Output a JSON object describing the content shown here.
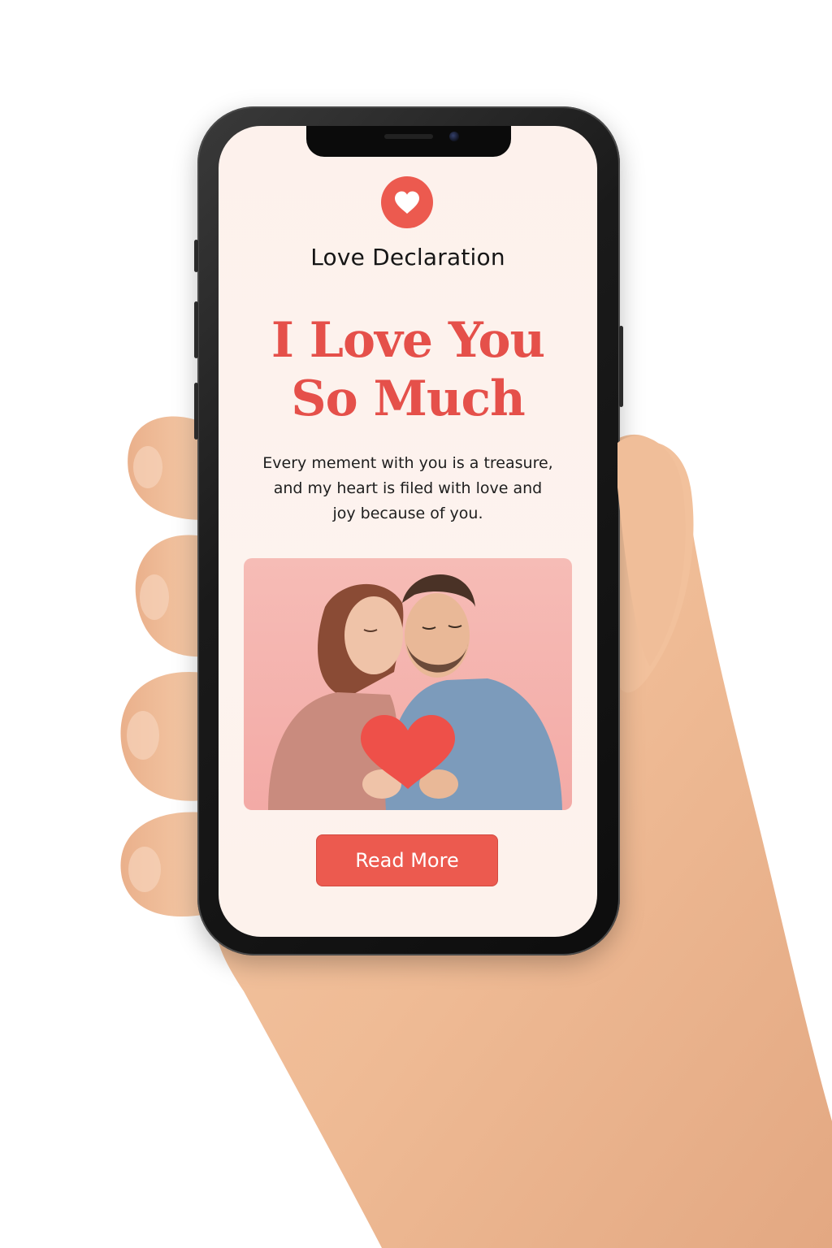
{
  "app": {
    "title": "Love Declaration",
    "logo_icon": "heart-icon"
  },
  "hero": {
    "headline_line1": "I Love You",
    "headline_line2": "So Much"
  },
  "message": {
    "line1": "Every mement with you is a treasure,",
    "line2": "and my heart is filed with love and",
    "line3": "joy because of you."
  },
  "photo": {
    "alt": "couple-holding-heart-photo"
  },
  "actions": {
    "read_more_label": "Read More"
  },
  "colors": {
    "accent": "#ec5a4f",
    "headline": "#e5504a",
    "background": "#fdf1ec",
    "text": "#1e1e1e"
  }
}
